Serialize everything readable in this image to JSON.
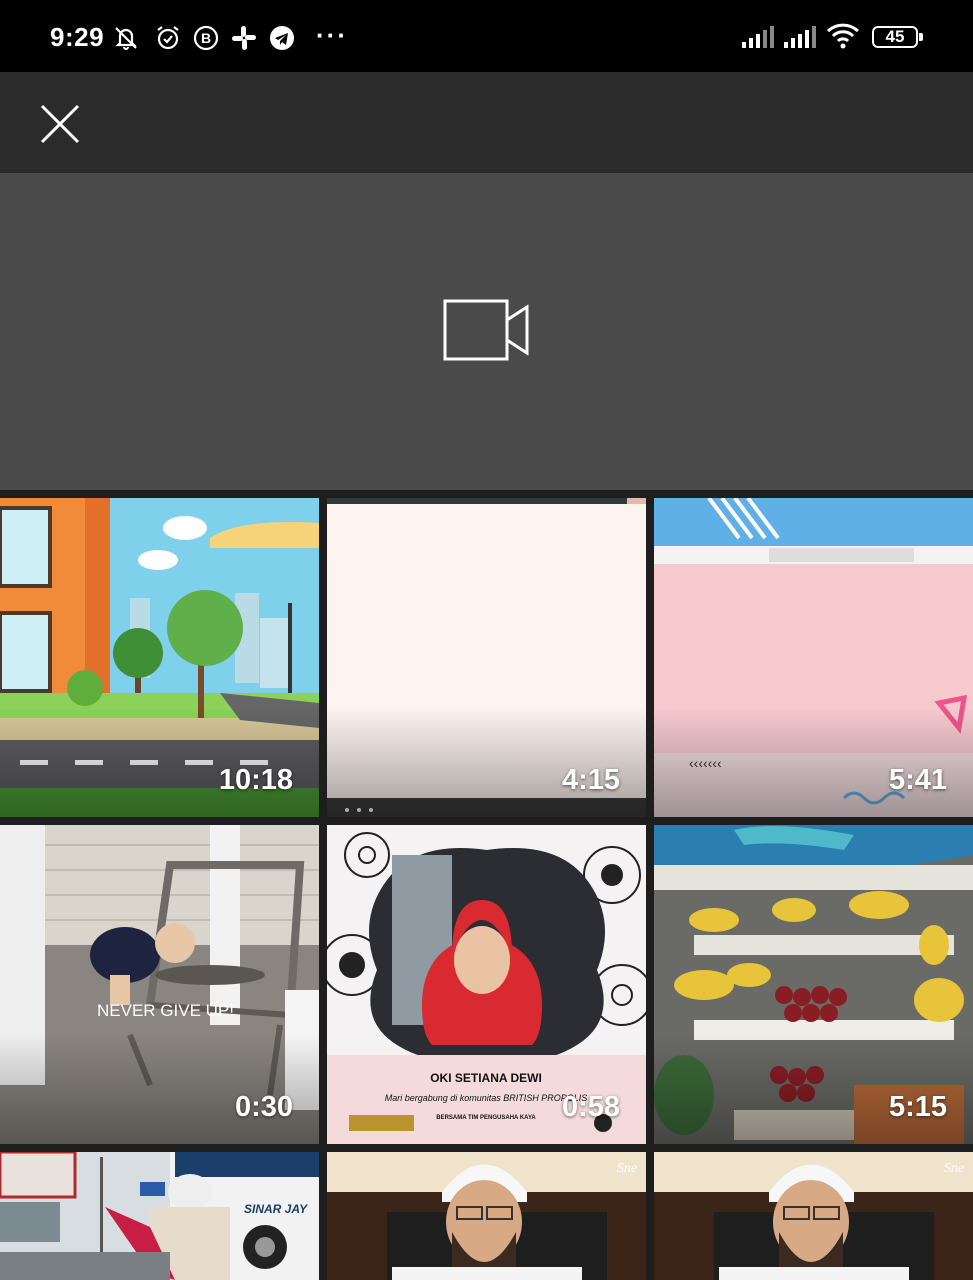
{
  "status_bar": {
    "time": "9:29",
    "more_indicator": "···",
    "battery": "45",
    "icons": [
      "mute-icon",
      "alarm-icon",
      "b-app-icon",
      "slack-icon",
      "telegram-icon"
    ]
  },
  "toolbar": {
    "close_icon": "close-icon"
  },
  "camera": {
    "icon": "video-camera-icon"
  },
  "videos": [
    {
      "duration": "10:18",
      "scene": "cartoon-street"
    },
    {
      "duration": "4:15",
      "scene": "blank-pink"
    },
    {
      "duration": "5:41",
      "scene": "pink-template"
    },
    {
      "duration": "0:30",
      "scene": "child-on-chair",
      "caption": "NEVER GIVE UP!"
    },
    {
      "duration": "0:58",
      "scene": "webinar-poster",
      "name": "OKI SETIANA DEWI",
      "line1": "Mari bergabung di komunitas BRITISH PROPOLIS",
      "line2": "BERSAMA TIM PENGUSAHA KAYA"
    },
    {
      "duration": "5:15",
      "scene": "fruit-stall"
    },
    {
      "duration": "",
      "scene": "street-bus",
      "bus_text": "SINAR JAY"
    },
    {
      "duration": "",
      "scene": "speaker",
      "logo": "Sne"
    },
    {
      "duration": "",
      "scene": "speaker",
      "logo": "Sne"
    }
  ],
  "colors": {
    "status_bar": "#000000",
    "toolbar": "#2b2b2b",
    "camera_area": "#4a4a4a",
    "grid_bg": "#1e1e1e"
  }
}
